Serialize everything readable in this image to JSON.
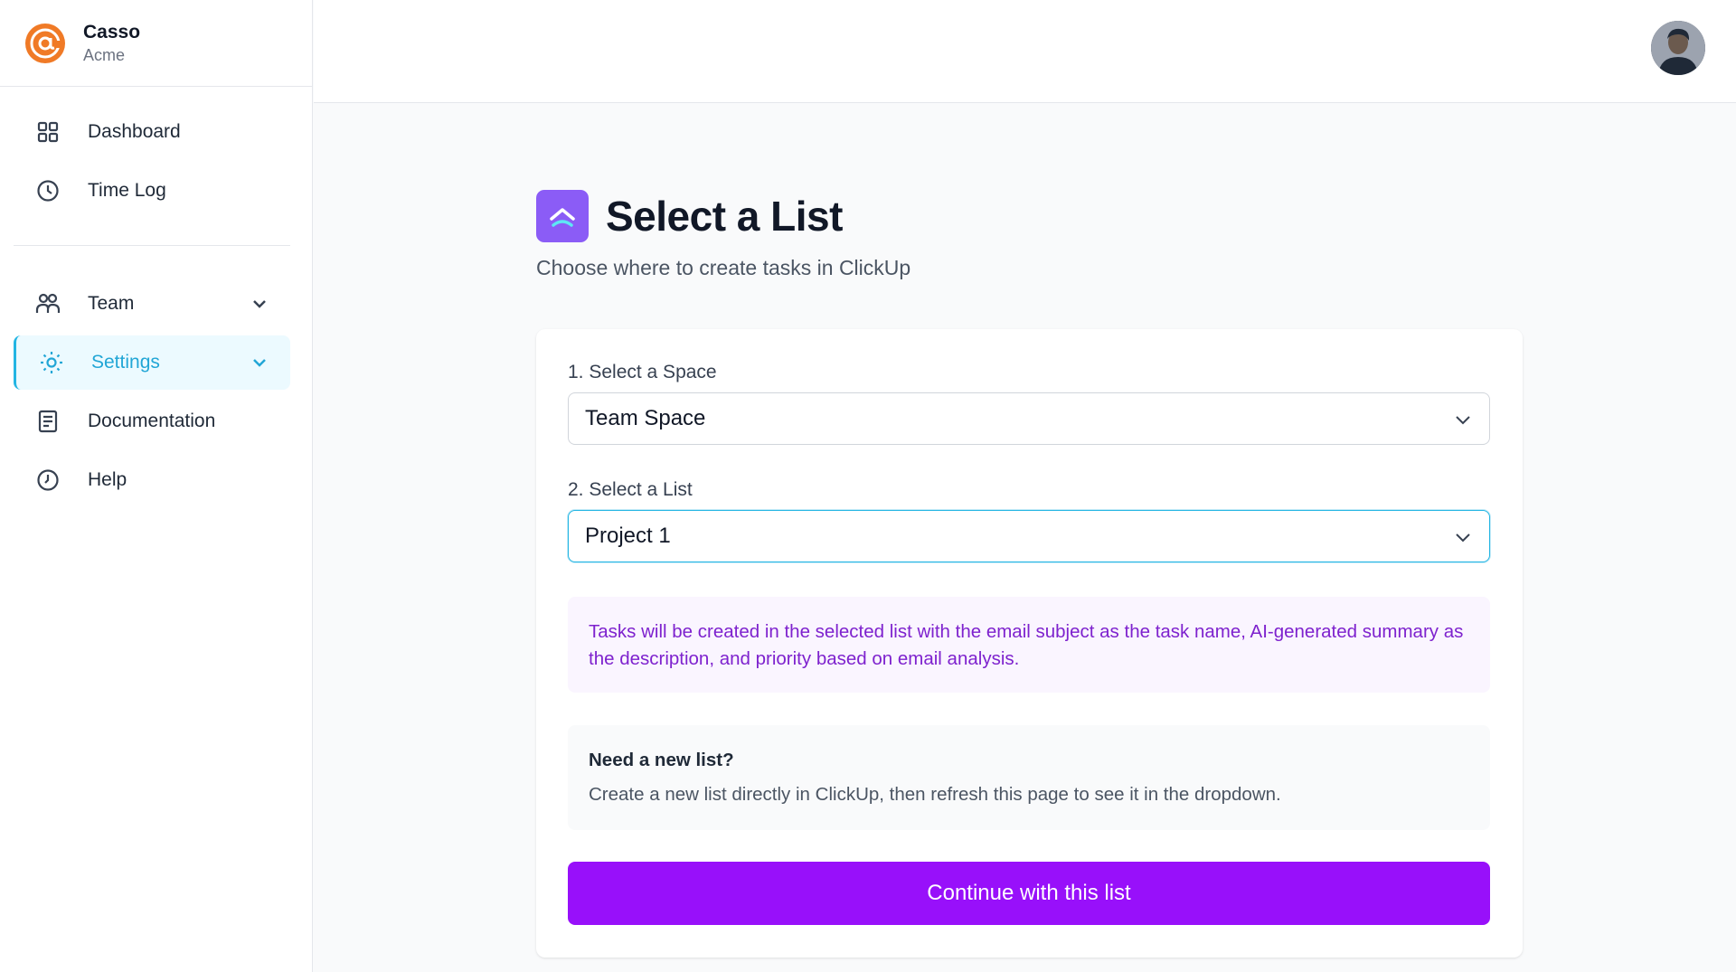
{
  "brand": {
    "name": "Casso",
    "org": "Acme"
  },
  "sidebar": {
    "items": [
      {
        "label": "Dashboard",
        "icon": "grid-icon"
      },
      {
        "label": "Time Log",
        "icon": "clock-icon"
      },
      {
        "label": "Team",
        "icon": "users-icon"
      },
      {
        "label": "Settings",
        "icon": "gear-icon"
      },
      {
        "label": "Documentation",
        "icon": "document-icon"
      },
      {
        "label": "Help",
        "icon": "help-icon"
      }
    ]
  },
  "page": {
    "title": "Select a List",
    "subtitle": "Choose where to create tasks in ClickUp"
  },
  "form": {
    "space_label": "1. Select a Space",
    "space_value": "Team Space",
    "list_label": "2. Select a List",
    "list_value": "Project 1",
    "info_text": "Tasks will be created in the selected list with the email subject as the task name, AI-generated summary as the description, and priority based on email analysis.",
    "note_title": "Need a new list?",
    "note_text": "Create a new list directly in ClickUp, then refresh this page to see it in the dropdown.",
    "continue_label": "Continue with this list"
  },
  "colors": {
    "accent": "#9810fa",
    "active_nav": "#22a6d6",
    "brand_logo": "#f07a26",
    "app_icon": "#8b5cf6"
  }
}
